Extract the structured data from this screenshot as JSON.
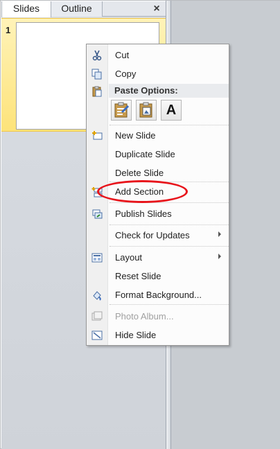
{
  "panel": {
    "tabs": [
      {
        "label": "Slides"
      },
      {
        "label": "Outline"
      }
    ],
    "close_glyph": "×",
    "slide_number": "1"
  },
  "context_menu": {
    "cut": "Cut",
    "copy": "Copy",
    "paste_options": "Paste Options:",
    "paste_text_only_glyph": "A",
    "new_slide": "New Slide",
    "duplicate_slide": "Duplicate Slide",
    "delete_slide": "Delete Slide",
    "add_section": "Add Section",
    "publish_slides": "Publish Slides",
    "check_for_updates": "Check for Updates",
    "layout": "Layout",
    "reset_slide": "Reset Slide",
    "format_background": "Format Background...",
    "photo_album": "Photo Album...",
    "hide_slide": "Hide Slide"
  },
  "colors": {
    "selection_gold": "#fde37a",
    "annotation_red": "#e8141b",
    "disabled_text": "#a0a0a0"
  }
}
